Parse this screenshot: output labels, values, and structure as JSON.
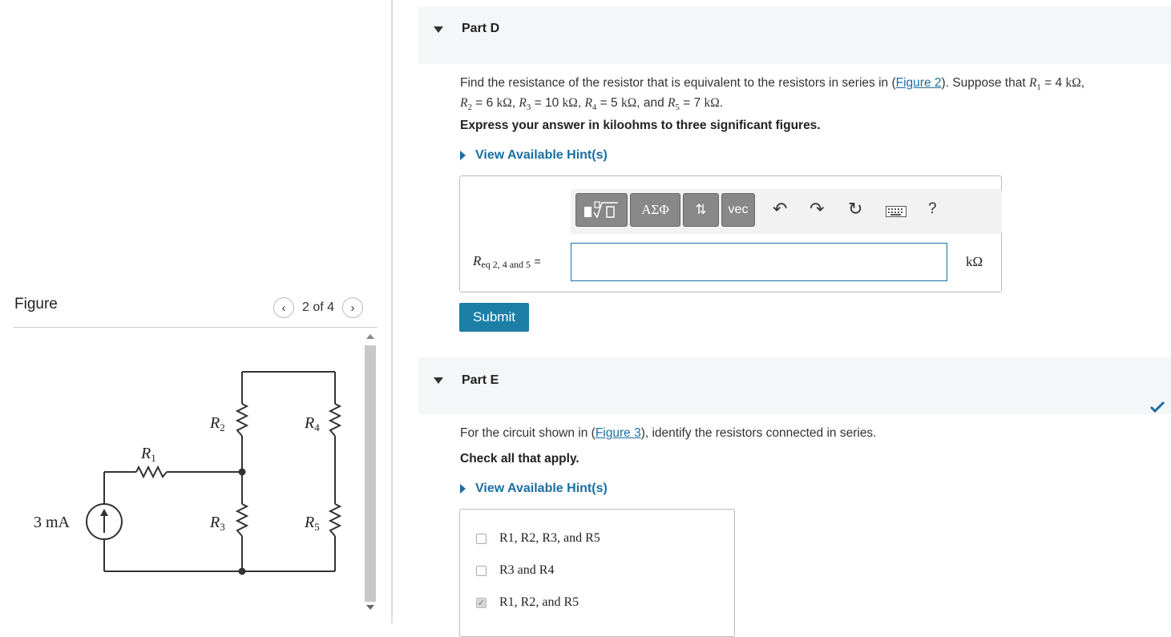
{
  "figure_panel": {
    "title": "Figure",
    "prev_icon": "chevron-left-icon",
    "next_icon": "chevron-right-icon",
    "pager": "2 of 4",
    "circuit": {
      "source_label": "3 mA",
      "resistors": [
        "R1",
        "R2",
        "R3",
        "R4",
        "R5"
      ]
    }
  },
  "part_d": {
    "title": "Part D",
    "question_pre": "Find the resistance of the resistor that is equivalent to the resistors in series in (",
    "question_link": "Figure 2",
    "question_post": "). Suppose that ",
    "values": {
      "R1": "4",
      "R2": "6",
      "R3": "10",
      "R4": "5",
      "R5": "7",
      "unit": "kΩ"
    },
    "instruction": "Express your answer in kiloohms to three significant figures.",
    "hint_label": "View Available Hint(s)",
    "toolbar": {
      "templates_icon": "math-template-icon",
      "greek_label": "ΑΣΦ",
      "arrows_icon": "up-down-arrows-icon",
      "vec_label": "vec",
      "undo_icon": "undo-icon",
      "redo_icon": "redo-icon",
      "reset_icon": "reset-icon",
      "keyboard_icon": "keyboard-icon",
      "help_label": "?"
    },
    "answer_label_sub": "eq 2, 4 and 5",
    "answer_value": "",
    "unit": "kΩ",
    "submit_label": "Submit"
  },
  "part_e": {
    "title": "Part E",
    "question_pre": "For the circuit shown in (",
    "question_link": "Figure 3",
    "question_post": "), identify the resistors connected in series.",
    "instruction": "Check all that apply.",
    "hint_label": "View Available Hint(s)",
    "status_icon": "checkmark-icon",
    "choices": [
      {
        "label": "R1, R2, R3, and R5",
        "checked": false
      },
      {
        "label": "R3 and R4",
        "checked": false
      },
      {
        "label": "R1, R2, and R5",
        "checked": true
      }
    ]
  },
  "colors": {
    "link": "#1a6fa3",
    "submit": "#1d7fa6",
    "header_bg": "#f5f6f7",
    "check": "#1d6fa0"
  }
}
